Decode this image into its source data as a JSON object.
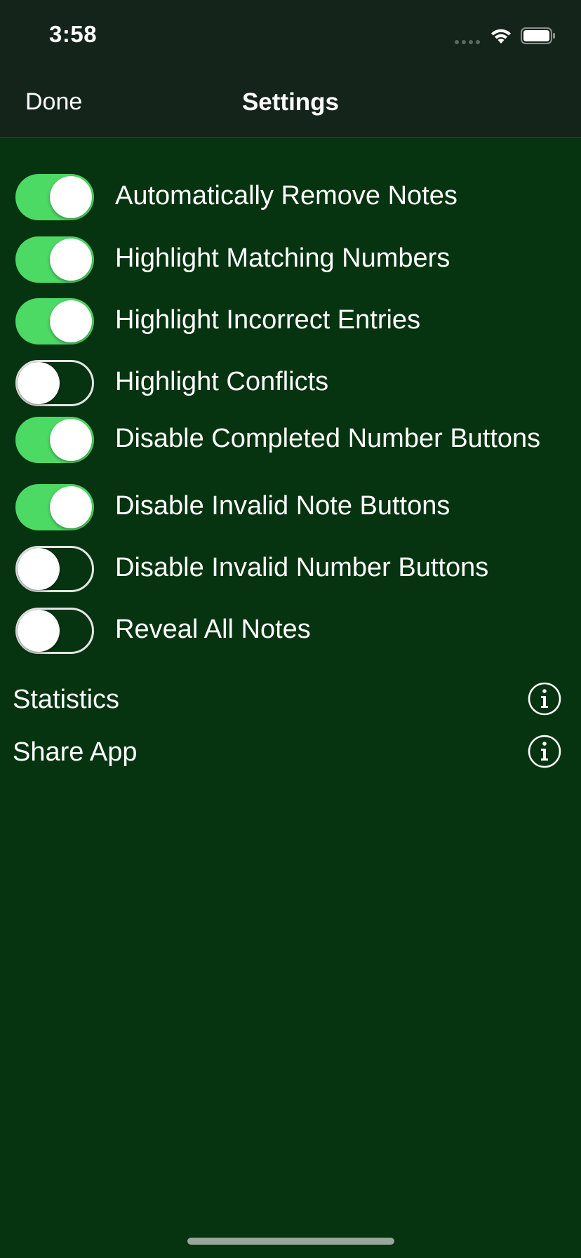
{
  "status_bar": {
    "time": "3:58"
  },
  "nav": {
    "done_label": "Done",
    "title": "Settings"
  },
  "toggles": [
    {
      "label": "Automatically Remove Notes",
      "on": true
    },
    {
      "label": "Highlight Matching Numbers",
      "on": true
    },
    {
      "label": "Highlight Incorrect Entries",
      "on": true
    },
    {
      "label": "Highlight Conflicts",
      "on": false
    },
    {
      "label": "Disable Completed Number Buttons",
      "on": true
    },
    {
      "label": "Disable Invalid Note Buttons",
      "on": true
    },
    {
      "label": "Disable Invalid Number Buttons",
      "on": false
    },
    {
      "label": "Reveal All Notes",
      "on": false
    }
  ],
  "links": [
    {
      "label": "Statistics",
      "icon": "info-circle-icon"
    },
    {
      "label": "Share App",
      "icon": "info-circle-icon"
    }
  ],
  "colors": {
    "background": "#063410",
    "topbar": "#15241a",
    "switch_on": "#4cd964",
    "text": "#ffffff"
  }
}
